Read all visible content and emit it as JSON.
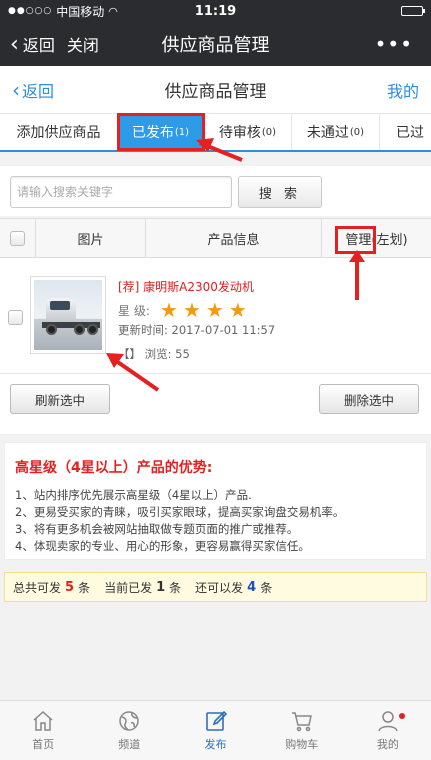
{
  "status": {
    "carrier": "中国移动",
    "time": "11:19"
  },
  "nav": {
    "back": "返回",
    "close": "关闭",
    "title": "供应商品管理",
    "more": "•••"
  },
  "header": {
    "back": "返回",
    "title": "供应商品管理",
    "mine": "我的"
  },
  "tabs": [
    {
      "label": "添加供应商品",
      "count": ""
    },
    {
      "label": "已发布",
      "count": "(1)"
    },
    {
      "label": "待审核",
      "count": "(0)"
    },
    {
      "label": "未通过",
      "count": "(0)"
    },
    {
      "label": "已过",
      "count": ""
    }
  ],
  "search": {
    "placeholder": "请输入搜索关键字",
    "button": "搜 索"
  },
  "table": {
    "headers": [
      "图片",
      "产品信息",
      "管理(左划)"
    ],
    "rows": [
      {
        "name": "[荐] 康明斯A2300发动机",
        "star_label": "星 级:",
        "stars": 4,
        "updated": "更新时间: 2017-07-01 11:57",
        "views": "【】 浏览: 55"
      }
    ]
  },
  "actions": {
    "refresh": "刷新选中",
    "delete": "删除选中"
  },
  "tips": {
    "title": "高星级（4星以上）产品的优势:",
    "lines": [
      "1、站内排序优先展示高星级（4星以上）产品.",
      "2、更易受买家的青睐，吸引买家眼球，提高买家询盘交易机率。",
      "3、将有更多机会被网站抽取做专题页面的推广或推荐。",
      "4、体现卖家的专业、用心的形象，更容易赢得买家信任。"
    ]
  },
  "summary": {
    "t1": "总共可发",
    "v1": "5",
    "u1": "条",
    "t2": "当前已发",
    "v2": "1",
    "u2": "条",
    "t3": "还可以发",
    "v3": "4",
    "u3": "条"
  },
  "tabbar": [
    {
      "label": "首页",
      "icon": "home-icon"
    },
    {
      "label": "频道",
      "icon": "globe-icon"
    },
    {
      "label": "发布",
      "icon": "edit-icon"
    },
    {
      "label": "购物车",
      "icon": "cart-icon"
    },
    {
      "label": "我的",
      "icon": "user-icon"
    }
  ],
  "colors": {
    "accent": "#2d8de0",
    "annotation": "#e52020",
    "star": "#f39a10",
    "topbar": "#2a2c30"
  }
}
